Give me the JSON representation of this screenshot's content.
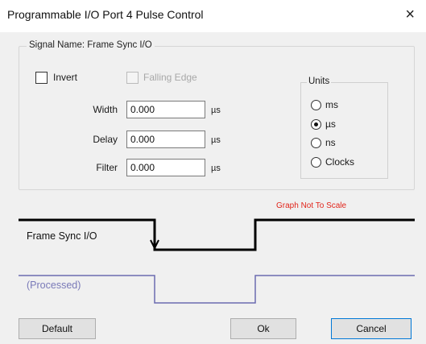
{
  "window": {
    "title": "Programmable I/O Port 4 Pulse Control",
    "close_symbol": "×"
  },
  "signal": {
    "group_title": "Signal Name: Frame Sync I/O",
    "invert_label": "Invert",
    "invert_checked": false,
    "falling_edge_label": "Falling Edge",
    "falling_edge_enabled": false
  },
  "fields": {
    "width_label": "Width",
    "width_value": "0.000",
    "width_unit": "µs",
    "delay_label": "Delay",
    "delay_value": "0.000",
    "delay_unit": "µs",
    "filter_label": "Filter",
    "filter_value": "0.000",
    "filter_unit": "µs"
  },
  "units": {
    "title": "Units",
    "options": [
      "ms",
      "µs",
      "ns",
      "Clocks"
    ],
    "selected": "µs"
  },
  "graph": {
    "note": "Graph Not To Scale",
    "note_color": "#e1251b",
    "signal_label": "Frame Sync I/O",
    "processed_label": "(Processed)",
    "signal_color": "#000000",
    "processed_color": "#6b6bb0"
  },
  "buttons": {
    "default_label": "Default",
    "ok_label": "Ok",
    "cancel_label": "Cancel"
  }
}
